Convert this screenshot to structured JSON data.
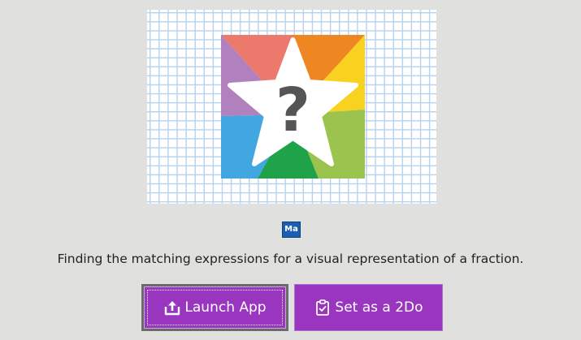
{
  "activity": {
    "description": "Finding the matching expressions for a visual representation of a fraction.",
    "subject_badge": "Ma",
    "thumbnail_icon": "question-star-icon"
  },
  "actions": {
    "launch_label": "Launch App",
    "launch_icon": "launch-upload-icon",
    "twodo_label": "Set as a 2Do",
    "twodo_icon": "clipboard-check-icon"
  },
  "colors": {
    "page_background": "#e0e0df",
    "button_purple": "#9a35c0",
    "badge_blue": "#1a5fb0",
    "grid_line": "#b7d3ee"
  }
}
